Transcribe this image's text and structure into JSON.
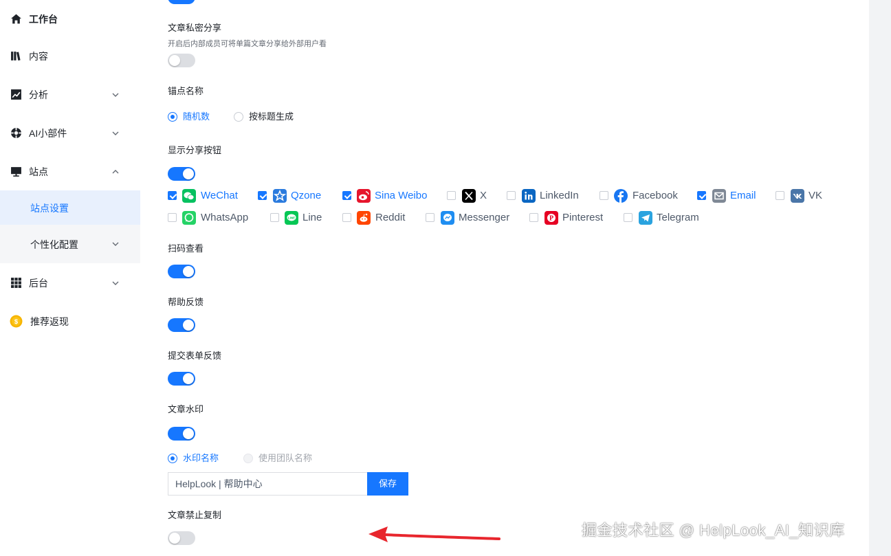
{
  "sidebar": {
    "items": [
      {
        "label": "工作台",
        "icon": "home-icon"
      },
      {
        "label": "内容",
        "icon": "book-icon"
      },
      {
        "label": "分析",
        "icon": "chart-icon"
      },
      {
        "label": "AI小部件",
        "icon": "ai-widget-icon"
      },
      {
        "label": "站点",
        "icon": "monitor-icon"
      },
      {
        "label": "后台",
        "icon": "grid-icon"
      },
      {
        "label": "推荐返现",
        "icon": "coin-icon"
      }
    ],
    "sub_items": [
      {
        "label": "站点设置",
        "active": true
      },
      {
        "label": "个性化配置",
        "active": false
      }
    ]
  },
  "settings": {
    "private_share": {
      "title": "文章私密分享",
      "desc": "开启后内部成员可将单篇文章分享给外部用户看",
      "enabled": false
    },
    "anchor": {
      "title": "锚点名称",
      "options": [
        "随机数",
        "按标题生成"
      ],
      "selected": "随机数"
    },
    "share_buttons": {
      "title": "显示分享按钮",
      "enabled": true,
      "platforms": [
        {
          "label": "WeChat",
          "checked": true,
          "icon": "wechat-icon",
          "color": "#07c160"
        },
        {
          "label": "Qzone",
          "checked": true,
          "icon": "qzone-icon",
          "color": "#2b7bde"
        },
        {
          "label": "Sina Weibo",
          "checked": true,
          "icon": "weibo-icon",
          "color": "#e6162d"
        },
        {
          "label": "X",
          "checked": false,
          "icon": "x-icon",
          "color": "#000000"
        },
        {
          "label": "LinkedIn",
          "checked": false,
          "icon": "linkedin-icon",
          "color": "#0a66c2"
        },
        {
          "label": "Facebook",
          "checked": false,
          "icon": "facebook-icon",
          "color": "#1877f2"
        },
        {
          "label": "Email",
          "checked": true,
          "icon": "email-icon",
          "color": "#7f8895"
        },
        {
          "label": "VK",
          "checked": false,
          "icon": "vk-icon",
          "color": "#4a76a8"
        },
        {
          "label": "WhatsApp",
          "checked": false,
          "icon": "whatsapp-icon",
          "color": "#25d366"
        },
        {
          "label": "Line",
          "checked": false,
          "icon": "line-icon",
          "color": "#06c755"
        },
        {
          "label": "Reddit",
          "checked": false,
          "icon": "reddit-icon",
          "color": "#ff4500"
        },
        {
          "label": "Messenger",
          "checked": false,
          "icon": "messenger-icon",
          "color": "#1f8ef1"
        },
        {
          "label": "Pinterest",
          "checked": false,
          "icon": "pinterest-icon",
          "color": "#e60023"
        },
        {
          "label": "Telegram",
          "checked": false,
          "icon": "telegram-icon",
          "color": "#2aa3df"
        }
      ]
    },
    "qr_view": {
      "title": "扫码查看",
      "enabled": true
    },
    "help_feedback": {
      "title": "帮助反馈",
      "enabled": true
    },
    "form_feedback": {
      "title": "提交表单反馈",
      "enabled": true
    },
    "watermark": {
      "title": "文章水印",
      "enabled": true,
      "options": [
        "水印名称",
        "使用团队名称"
      ],
      "selected": "水印名称",
      "input_value": "HelpLook | 帮助中心",
      "save_label": "保存"
    },
    "no_copy": {
      "title": "文章禁止复制",
      "enabled": false
    }
  },
  "colors": {
    "accent": "#1677ff",
    "annotation_arrow": "#e8262d"
  },
  "overlay": {
    "watermark_text": "掘金技术社区 @ HelpLook_AI_知识库"
  }
}
